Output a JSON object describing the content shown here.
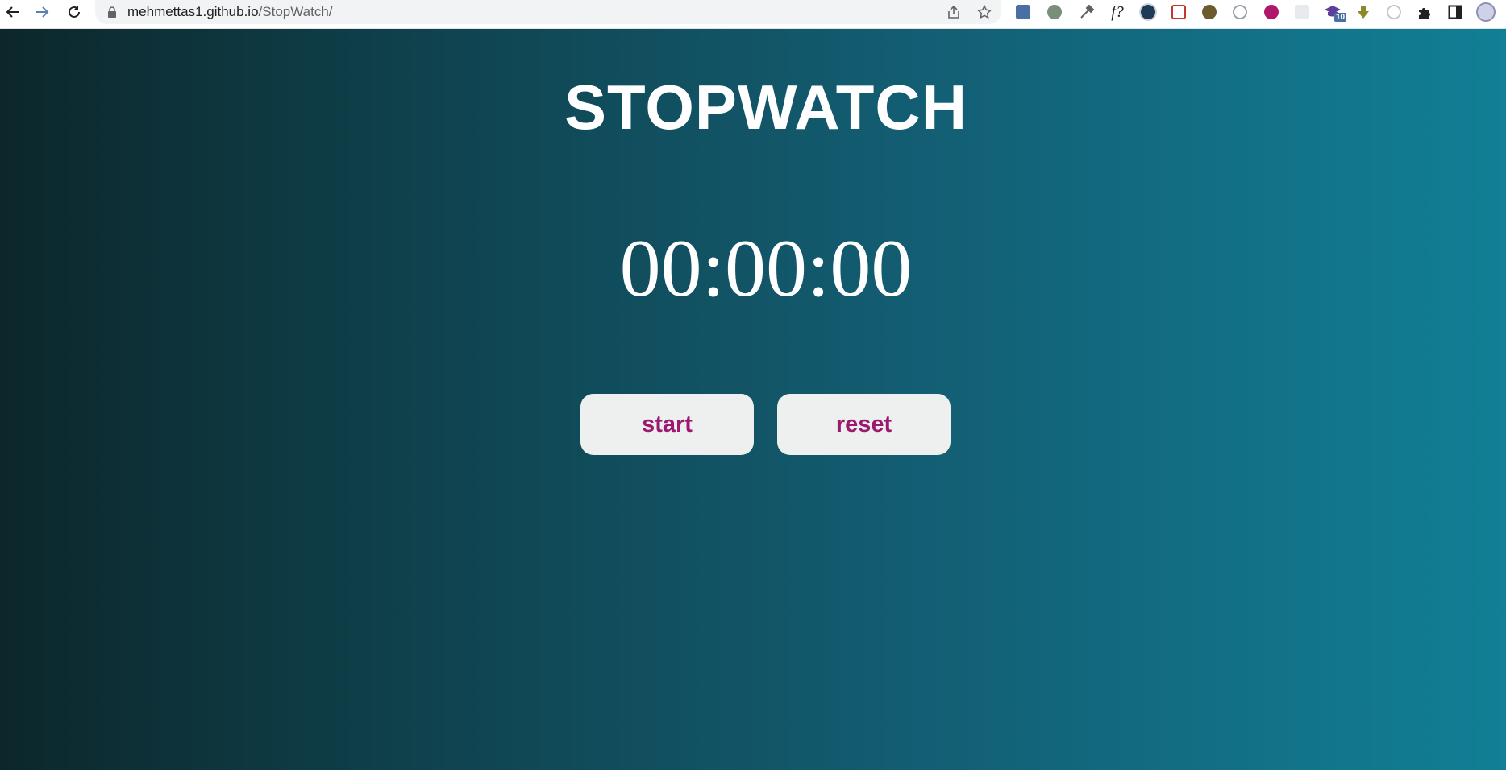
{
  "browser": {
    "url_host": "mehmettas1.github.io",
    "url_path": "/StopWatch/",
    "extensions": [
      {
        "name": "translate-extension",
        "color": "#4a6fa5"
      },
      {
        "name": "bug-extension",
        "color": "#7a8f7a"
      },
      {
        "name": "color-picker-extension",
        "color": "#5f6368"
      },
      {
        "name": "font-identifier-extension",
        "label": "f?"
      },
      {
        "name": "ninja-extension",
        "color": "#1f3b57"
      },
      {
        "name": "calendar-extension",
        "color": "#c0392b"
      },
      {
        "name": "html-tree-extension",
        "color": "#6b5b2e"
      },
      {
        "name": "compass-extension",
        "color": "#9aa0a6"
      },
      {
        "name": "pink-face-extension",
        "color": "#b0166b"
      },
      {
        "name": "blank-extension",
        "color": "#e8eaed"
      },
      {
        "name": "graduation-cap-extension",
        "color": "#5b3f9a",
        "badge": "10"
      },
      {
        "name": "download-arrow-extension",
        "color": "#8a8a2a"
      },
      {
        "name": "timer-extension",
        "color": "#c7c9cc"
      }
    ]
  },
  "page": {
    "title": "STOPWATCH",
    "time": "00:00:00",
    "start_label": "start",
    "reset_label": "reset"
  },
  "colors": {
    "gradient_left": "#0c272b",
    "gradient_right": "#117f96",
    "button_bg": "#eef0f0",
    "button_text": "#9c1a6e"
  }
}
